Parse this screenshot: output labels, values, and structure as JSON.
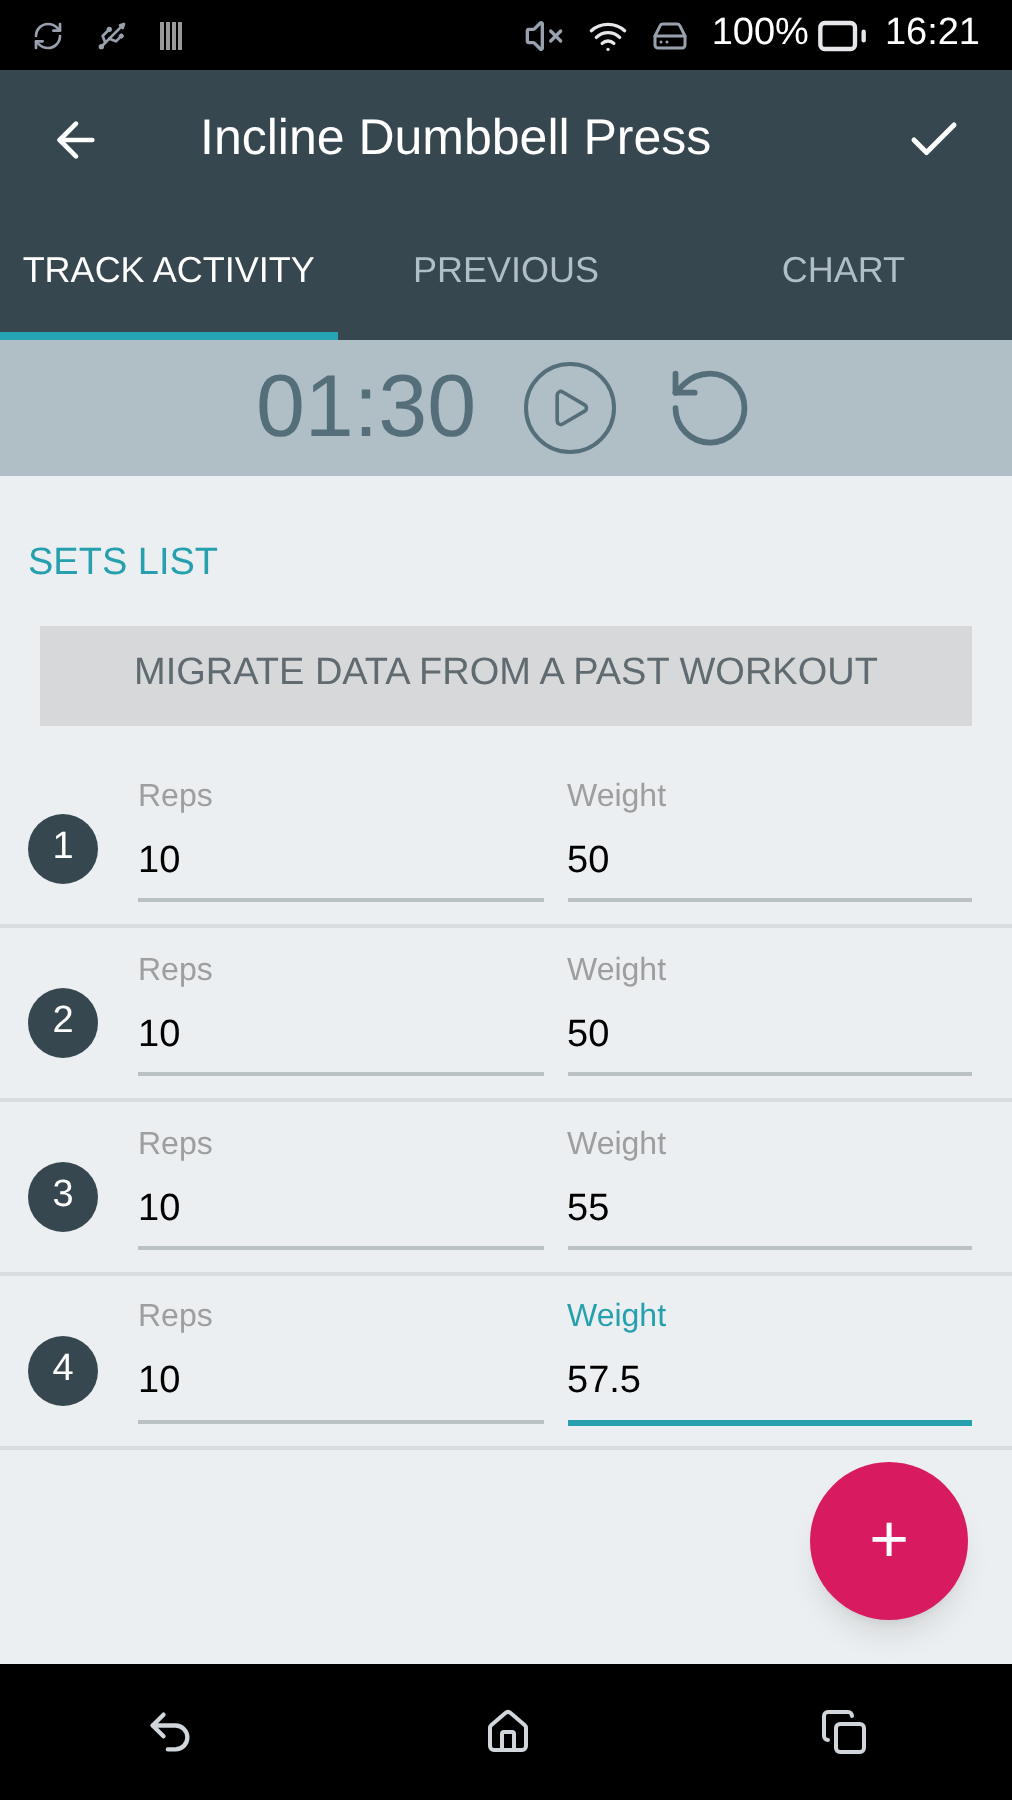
{
  "status_bar": {
    "battery": "100%",
    "time": "16:21"
  },
  "toolbar": {
    "title": "Incline Dumbbell Press"
  },
  "tabs": [
    {
      "label": "TRACK ACTIVITY",
      "selected": true
    },
    {
      "label": "PREVIOUS",
      "selected": false
    },
    {
      "label": "CHART",
      "selected": false
    }
  ],
  "timer": {
    "time": "01:30"
  },
  "section_title": "SETS LIST",
  "migrate_button": "MIGRATE DATA FROM A PAST WORKOUT",
  "sets": [
    {
      "number": "1",
      "fields": [
        {
          "label": "Reps",
          "value": "10",
          "focused": false
        },
        {
          "label": "Weight",
          "value": "50",
          "focused": false
        }
      ]
    },
    {
      "number": "2",
      "fields": [
        {
          "label": "Reps",
          "value": "10",
          "focused": false
        },
        {
          "label": "Weight",
          "value": "50",
          "focused": false
        }
      ]
    },
    {
      "number": "3",
      "fields": [
        {
          "label": "Reps",
          "value": "10",
          "focused": false
        },
        {
          "label": "Weight",
          "value": "55",
          "focused": false
        }
      ]
    },
    {
      "number": "4",
      "fields": [
        {
          "label": "Reps",
          "value": "10",
          "focused": false
        },
        {
          "label": "Weight",
          "value": "57.5",
          "focused": true
        }
      ]
    }
  ],
  "fab": "+"
}
